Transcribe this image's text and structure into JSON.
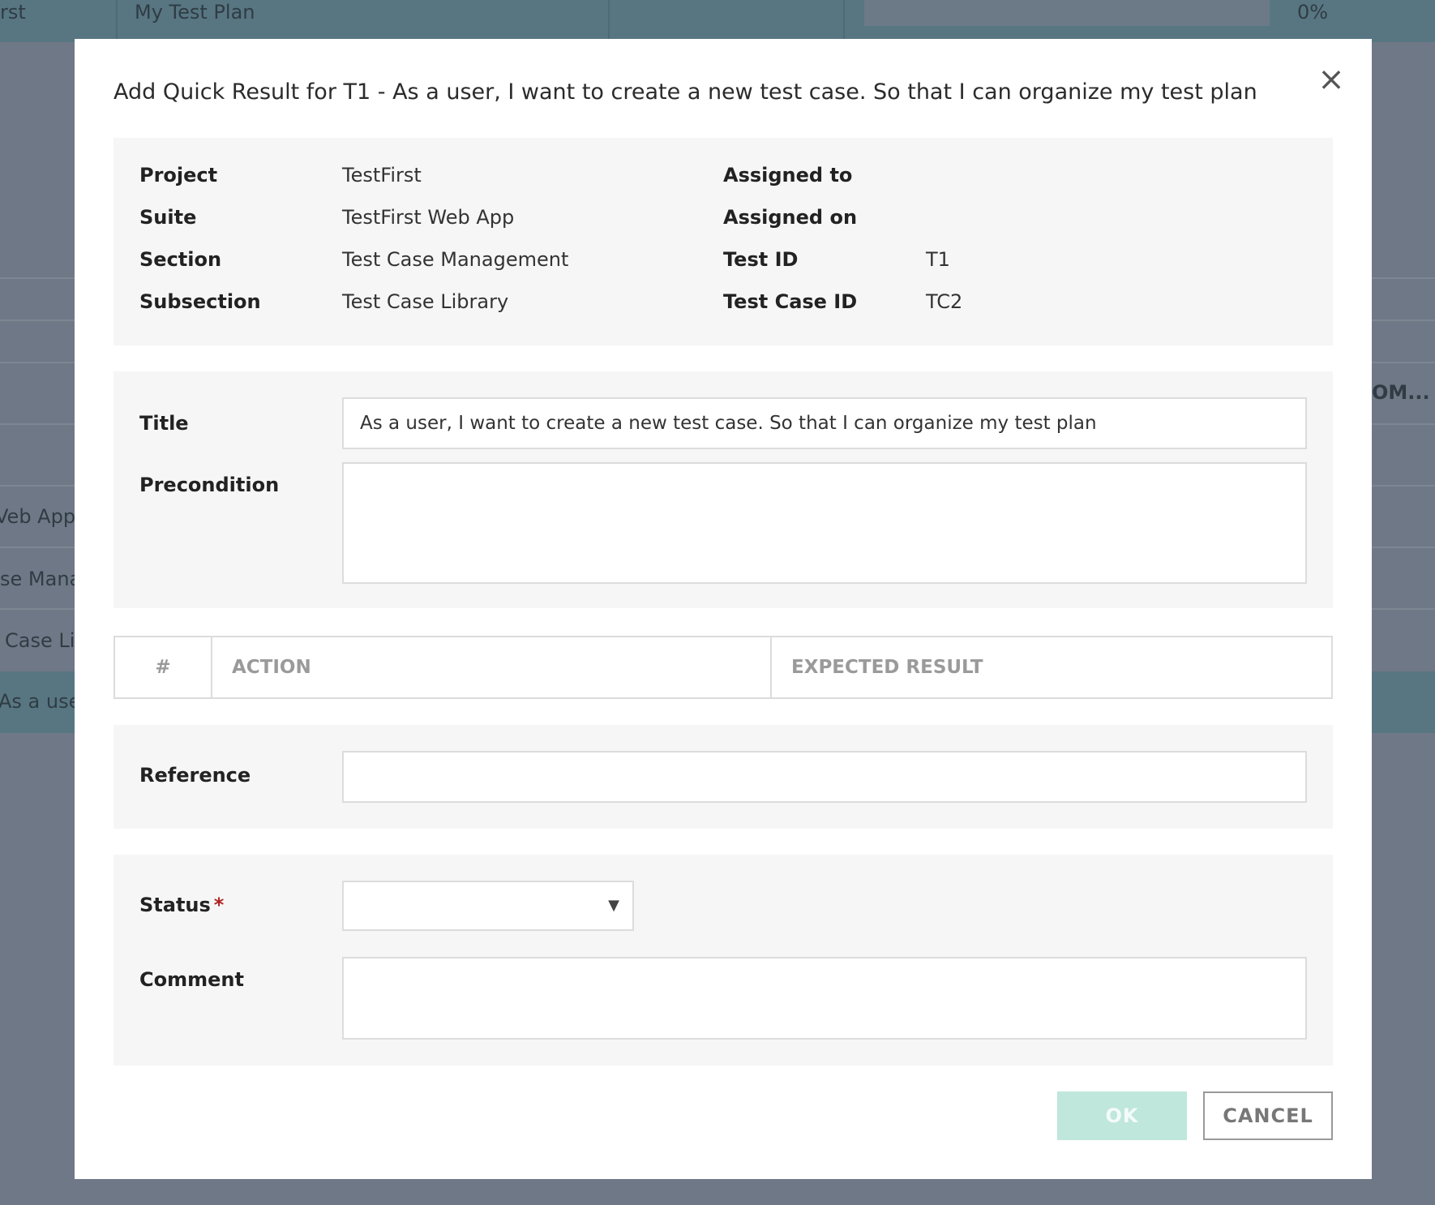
{
  "background": {
    "topbar": {
      "col1": "rst",
      "col2": "My Test Plan",
      "percent": "0%"
    },
    "rows": {
      "right_truncated": "OM...",
      "suite_truncated": "Veb App",
      "section_truncated": "se Mana",
      "subsection_truncated": "Case Li",
      "title_truncated": "As a use"
    }
  },
  "modal": {
    "title": "Add Quick Result for T1 - As a user, I want to create a new test case. So that I can organize my test plan",
    "close_icon": "×",
    "info": {
      "project_label": "Project",
      "project_value": "TestFirst",
      "suite_label": "Suite",
      "suite_value": "TestFirst Web App",
      "section_label": "Section",
      "section_value": "Test Case Management",
      "subsection_label": "Subsection",
      "subsection_value": "Test Case Library",
      "assigned_to_label": "Assigned to",
      "assigned_to_value": "",
      "assigned_on_label": "Assigned on",
      "assigned_on_value": "",
      "test_id_label": "Test ID",
      "test_id_value": "T1",
      "test_case_id_label": "Test Case ID",
      "test_case_id_value": "TC2"
    },
    "title_field": {
      "label": "Title",
      "value": "As a user, I want to create a new test case. So that I can organize my test plan"
    },
    "precondition_field": {
      "label": "Precondition",
      "value": ""
    },
    "steps_table": {
      "col_number": "#",
      "col_action": "ACTION",
      "col_expected": "EXPECTED RESULT"
    },
    "reference_field": {
      "label": "Reference",
      "value": ""
    },
    "status_field": {
      "label": "Status",
      "required_marker": "*",
      "selected": "",
      "caret": "▼"
    },
    "comment_field": {
      "label": "Comment",
      "value": ""
    },
    "buttons": {
      "ok": "OK",
      "cancel": "CANCEL"
    }
  },
  "colors": {
    "overlay": "#6f7886",
    "ok_button": "#bfe7dc",
    "panel": "#f6f6f6",
    "required": "#b02222"
  }
}
